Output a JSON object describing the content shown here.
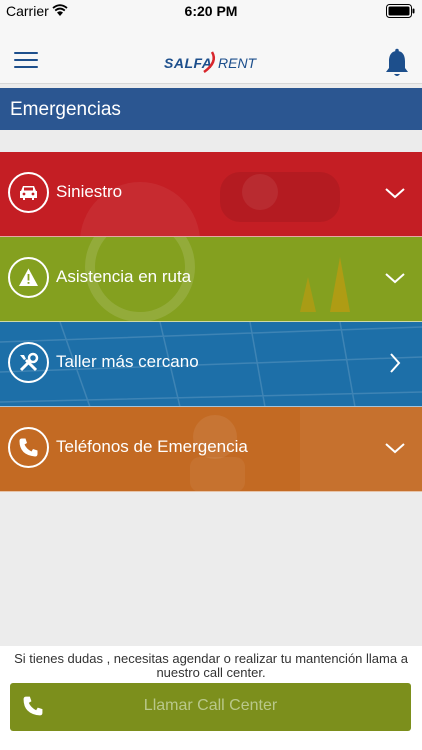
{
  "status_bar": {
    "carrier": "Carrier",
    "time": "6:20 PM"
  },
  "header": {
    "logo_left": "SALFA",
    "logo_right": "RENT"
  },
  "page": {
    "title": "Emergencias"
  },
  "menu": {
    "items": [
      {
        "label": "Siniestro",
        "icon": "car-icon",
        "color": "#c41e24",
        "chevron": "chevron-down-icon"
      },
      {
        "label": "Asistencia en ruta",
        "icon": "warning-icon",
        "color": "#84a01f",
        "chevron": "chevron-down-icon"
      },
      {
        "label": "Taller más cercano",
        "icon": "tools-icon",
        "color": "#1d6fa8",
        "chevron": "chevron-right-icon"
      },
      {
        "label": "Teléfonos de Emergencia",
        "icon": "phone-icon",
        "color": "#c36a23",
        "chevron": "chevron-down-icon"
      }
    ]
  },
  "footer": {
    "note": "Si tienes dudas , necesitas agendar o realizar tu mantención llama a nuestro call center.",
    "call_button": "Llamar Call Center"
  }
}
